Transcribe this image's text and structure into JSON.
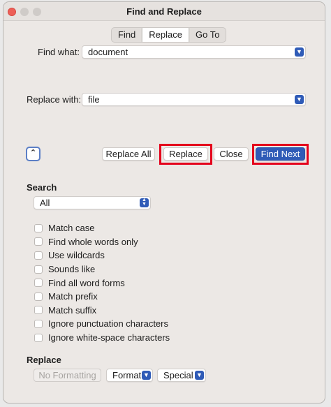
{
  "window": {
    "title": "Find and Replace"
  },
  "tabs": [
    {
      "label": "Find",
      "active": false
    },
    {
      "label": "Replace",
      "active": true
    },
    {
      "label": "Go To",
      "active": false
    }
  ],
  "find": {
    "label": "Find what:",
    "value": "document"
  },
  "replace": {
    "label": "Replace with:",
    "value": "file"
  },
  "buttons": {
    "replace_all": "Replace All",
    "replace": "Replace",
    "close": "Close",
    "find_next": "Find Next"
  },
  "search": {
    "heading": "Search",
    "selected": "All",
    "options": [
      "Match case",
      "Find whole words only",
      "Use wildcards",
      "Sounds like",
      "Find all word forms",
      "Match prefix",
      "Match suffix",
      "Ignore punctuation characters",
      "Ignore white-space characters"
    ]
  },
  "replace_section": {
    "heading": "Replace",
    "no_formatting": "No Formatting",
    "format": "Format",
    "special": "Special"
  },
  "colors": {
    "accent": "#2f5bb7",
    "highlight": "#e4001b",
    "window_bg": "#ece8e5"
  },
  "icons": {
    "collapse": "chevron-up-icon",
    "dropdown": "chevron-down-icon",
    "stepper": "up-down-arrows-icon"
  }
}
